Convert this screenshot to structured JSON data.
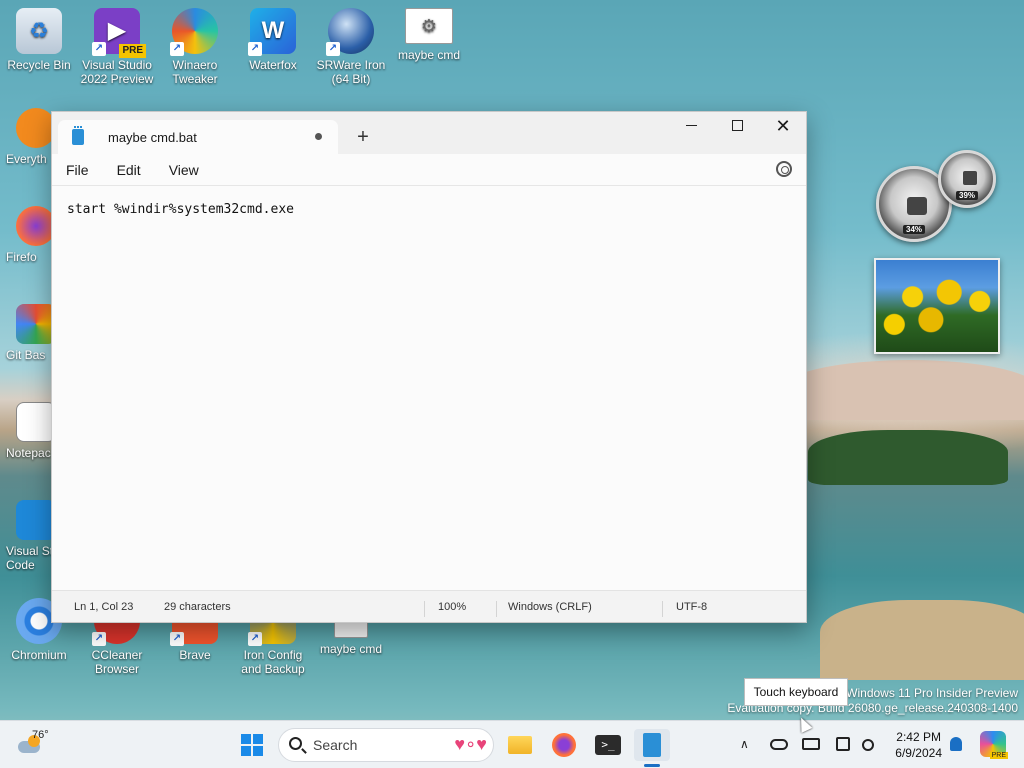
{
  "desktop": {
    "top_icons": [
      {
        "label": "Recycle Bin",
        "icon": "recycle-bin-icon"
      },
      {
        "label": "Visual Studio 2022 Preview",
        "badge": "PRE",
        "icon": "visual-studio-icon"
      },
      {
        "label": "Winaero Tweaker",
        "icon": "winaero-icon"
      },
      {
        "label": "Waterfox",
        "icon": "waterfox-icon"
      },
      {
        "label": "SRWare Iron (64 Bit)",
        "icon": "iron-icon"
      },
      {
        "label": "maybe cmd",
        "icon": "batch-file-icon"
      }
    ],
    "left_icons": [
      {
        "label": "Everyth",
        "icon": "everything-search-icon"
      },
      {
        "label": "Firefo",
        "icon": "firefox-icon"
      },
      {
        "label": "Git Bas",
        "icon": "git-bash-icon"
      },
      {
        "label": "Notepac",
        "icon": "notepad-icon"
      },
      {
        "label": "Visual St Code",
        "icon": "vscode-icon"
      }
    ],
    "bottom_icons": [
      {
        "label": "Chromium",
        "icon": "chromium-icon"
      },
      {
        "label": "CCleaner Browser",
        "icon": "ccleaner-icon"
      },
      {
        "label": "Brave",
        "icon": "brave-icon"
      },
      {
        "label": "Iron Config and Backup",
        "icon": "iron-config-icon"
      },
      {
        "label": "maybe cmd",
        "icon": "notepad-file-icon"
      }
    ],
    "gadgets": {
      "cpu_gauge_pct": "34%",
      "ram_gauge_pct": "39%"
    },
    "watermark": {
      "line1": "Windows 11 Pro Insider Preview",
      "line2": "Evaluation copy. Build 26080.ge_release.240308-1400"
    },
    "tooltip": "Touch keyboard"
  },
  "notepad": {
    "tab_title": "maybe cmd.bat",
    "new_tab_label": "+",
    "menu": [
      "File",
      "Edit",
      "View"
    ],
    "content": "start %windir%system32cmd.exe",
    "status": {
      "position": "Ln 1, Col 23",
      "characters": "29 characters",
      "zoom": "100%",
      "line_endings": "Windows (CRLF)",
      "encoding": "UTF-8"
    }
  },
  "taskbar": {
    "weather_temp": "76°",
    "search_placeholder": "Search",
    "clock_time": "2:42 PM",
    "clock_date": "6/9/2024",
    "copilot_badge": "PRE"
  }
}
